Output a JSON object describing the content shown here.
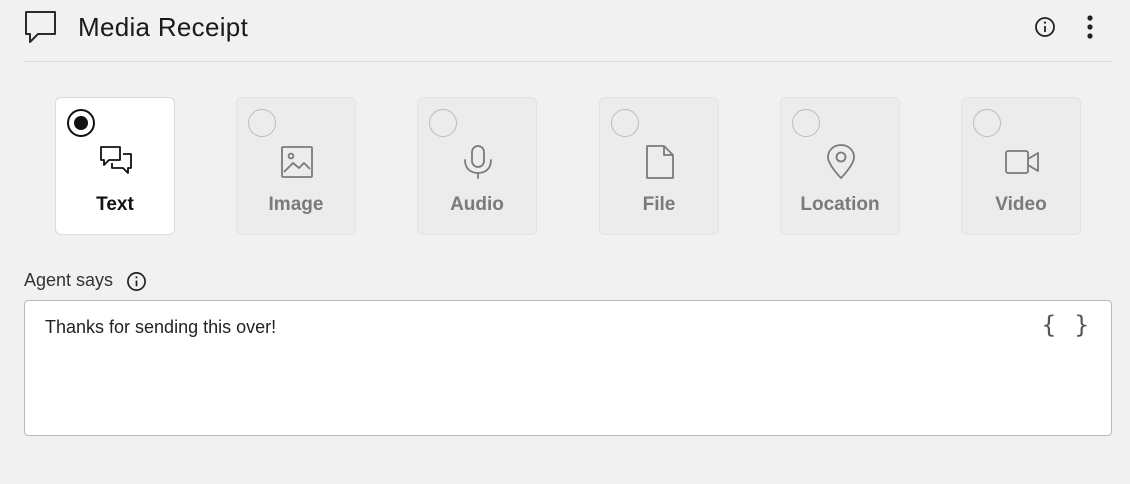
{
  "header": {
    "title": "Media Receipt",
    "icons": [
      "speech-bubble-icon",
      "info-icon",
      "more-vertical-icon"
    ]
  },
  "message_types": [
    {
      "label": "Text",
      "icon": "chat-bubbles-icon",
      "selected": true
    },
    {
      "label": "Image",
      "icon": "image-icon",
      "selected": false
    },
    {
      "label": "Audio",
      "icon": "microphone-icon",
      "selected": false
    },
    {
      "label": "File",
      "icon": "file-icon",
      "selected": false
    },
    {
      "label": "Location",
      "icon": "location-pin-icon",
      "selected": false
    },
    {
      "label": "Video",
      "icon": "video-camera-icon",
      "selected": false
    }
  ],
  "agent": {
    "label": "Agent says",
    "message": "Thanks for sending this over!",
    "variable_button": "{ }"
  }
}
